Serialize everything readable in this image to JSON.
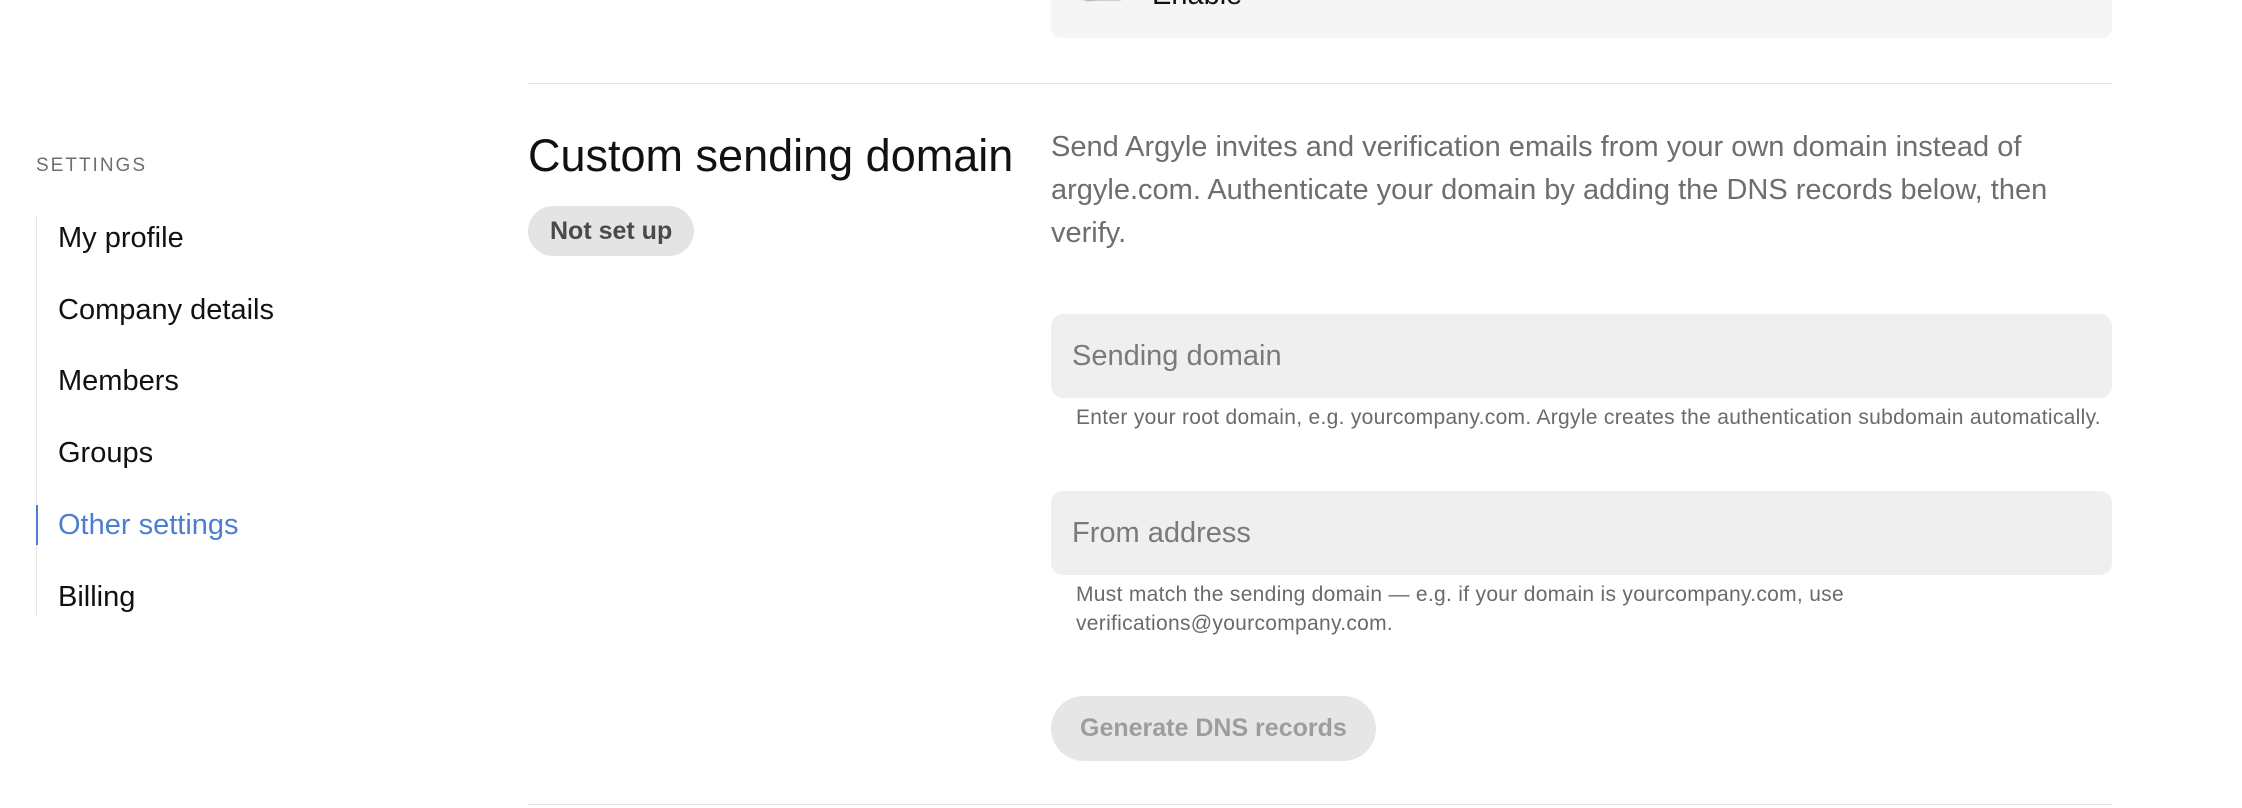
{
  "sidebar": {
    "heading": "SETTINGS",
    "items": [
      {
        "label": "My profile",
        "active": false
      },
      {
        "label": "Company details",
        "active": false
      },
      {
        "label": "Members",
        "active": false
      },
      {
        "label": "Groups",
        "active": false
      },
      {
        "label": "Other settings",
        "active": true
      },
      {
        "label": "Billing",
        "active": false
      }
    ]
  },
  "previous_section": {
    "toggle_label": "Enable",
    "toggle_on": false
  },
  "custom_domain": {
    "title": "Custom sending domain",
    "status": "Not set up",
    "description": "Send Argyle invites and verification emails from your own domain instead of argyle.com. Authenticate your domain by adding the DNS records below, then verify.",
    "sending_domain": {
      "placeholder": "Sending domain",
      "value": "",
      "helper": "Enter your root domain, e.g. yourcompany.com. Argyle creates the authentication subdomain automatically."
    },
    "from_address": {
      "placeholder": "From address",
      "value": "",
      "helper": "Must match the sending domain — e.g. if your domain is yourcompany.com, use verifications@yourcompany.com."
    },
    "generate_button": "Generate DNS records"
  },
  "colors": {
    "accent": "#4c7fd0",
    "badge_bg": "#e4e4e4",
    "input_bg": "#efefef",
    "button_disabled_bg": "#e6e6e6"
  }
}
